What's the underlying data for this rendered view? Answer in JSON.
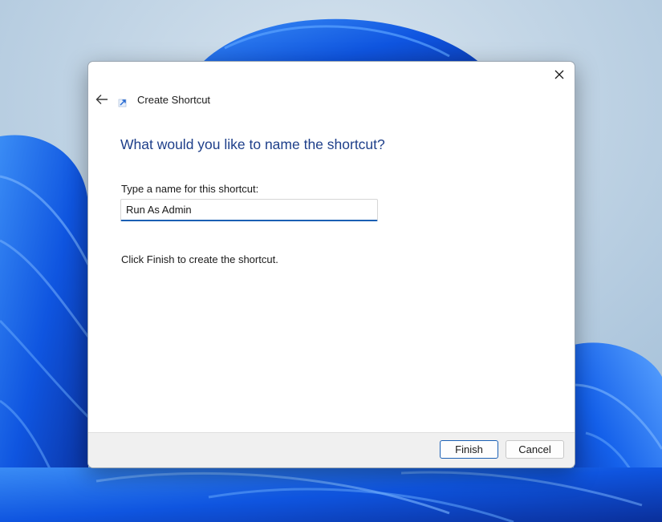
{
  "dialog": {
    "title": "Create Shortcut",
    "heading": "What would you like to name the shortcut?",
    "field_label": "Type a name for this shortcut:",
    "name_value": "Run As Admin",
    "finish_note": "Click Finish to create the shortcut.",
    "finish_label": "Finish",
    "cancel_label": "Cancel"
  },
  "icons": {
    "back": "back-arrow-icon",
    "close": "close-icon",
    "title": "shortcut-arrow-icon"
  },
  "colors": {
    "heading": "#1e3f8a",
    "accent": "#1a5fb4",
    "wallpaper_blue": "#1d5ee6",
    "wallpaper_bg": "#b9cfe0"
  }
}
